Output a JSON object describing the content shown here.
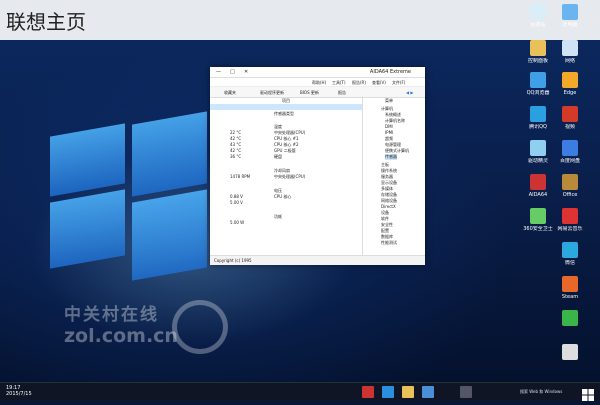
{
  "header": {
    "title": "联想主页"
  },
  "watermark": {
    "cn": "中关村在线",
    "en": "zol.com.cn"
  },
  "window": {
    "title": "AIDA64 Extreme",
    "menu": [
      "文件(F)",
      "查看(V)",
      "报告(R)",
      "工具(T)",
      "帮助(H)"
    ],
    "toolbar": [
      "报告",
      "BIOS 更新",
      "驱动程序更新",
      "收藏夹"
    ],
    "list_header": "项目",
    "tree_header": "菜单",
    "rows": [
      "传感器类型",
      "温度",
      "中央处理器(CPU)",
      "CPU 核心 #1",
      "CPU 核心 #2",
      "GPU 二极管",
      "硬盘",
      "冷却风扇",
      "中央处理器(CPU)",
      "电压",
      "CPU 核心",
      "功耗"
    ],
    "values": [
      "22 °C",
      "42 °C",
      "43 °C",
      "42 °C",
      "36 °C",
      "1478 RPM",
      "0.88 V",
      "5.00 V",
      "5.00 W"
    ],
    "tree": [
      "计算机",
      "系统概述",
      "计算机名称",
      "DMI",
      "IPMI",
      "超频",
      "电源管理",
      "便携式计算机",
      "传感器",
      "主板",
      "操作系统",
      "服务器",
      "显示设备",
      "多媒体",
      "存储设备",
      "网络设备",
      "DirectX",
      "设备",
      "软件",
      "安全性",
      "配置",
      "数据库",
      "性能测试"
    ],
    "status": "Copyright (c) 1995"
  },
  "desktop_icons": [
    "回收站",
    "此电脑",
    "控制面板",
    "网络",
    "QQ浏览器",
    "Edge",
    "腾讯QQ",
    "视频",
    "驱动精灵",
    "百度网盘",
    "AIDA64",
    "Office",
    "360安全卫士",
    "网易云音乐",
    "微信",
    "Steam"
  ],
  "taskbar": {
    "clock_time": "19:17",
    "clock_date": "2015/7/15",
    "tray": "搜索 Web 和 Windows"
  },
  "colors": {
    "accent": "#1e88e5",
    "wallpaper_dark": "#0a1f4c"
  }
}
